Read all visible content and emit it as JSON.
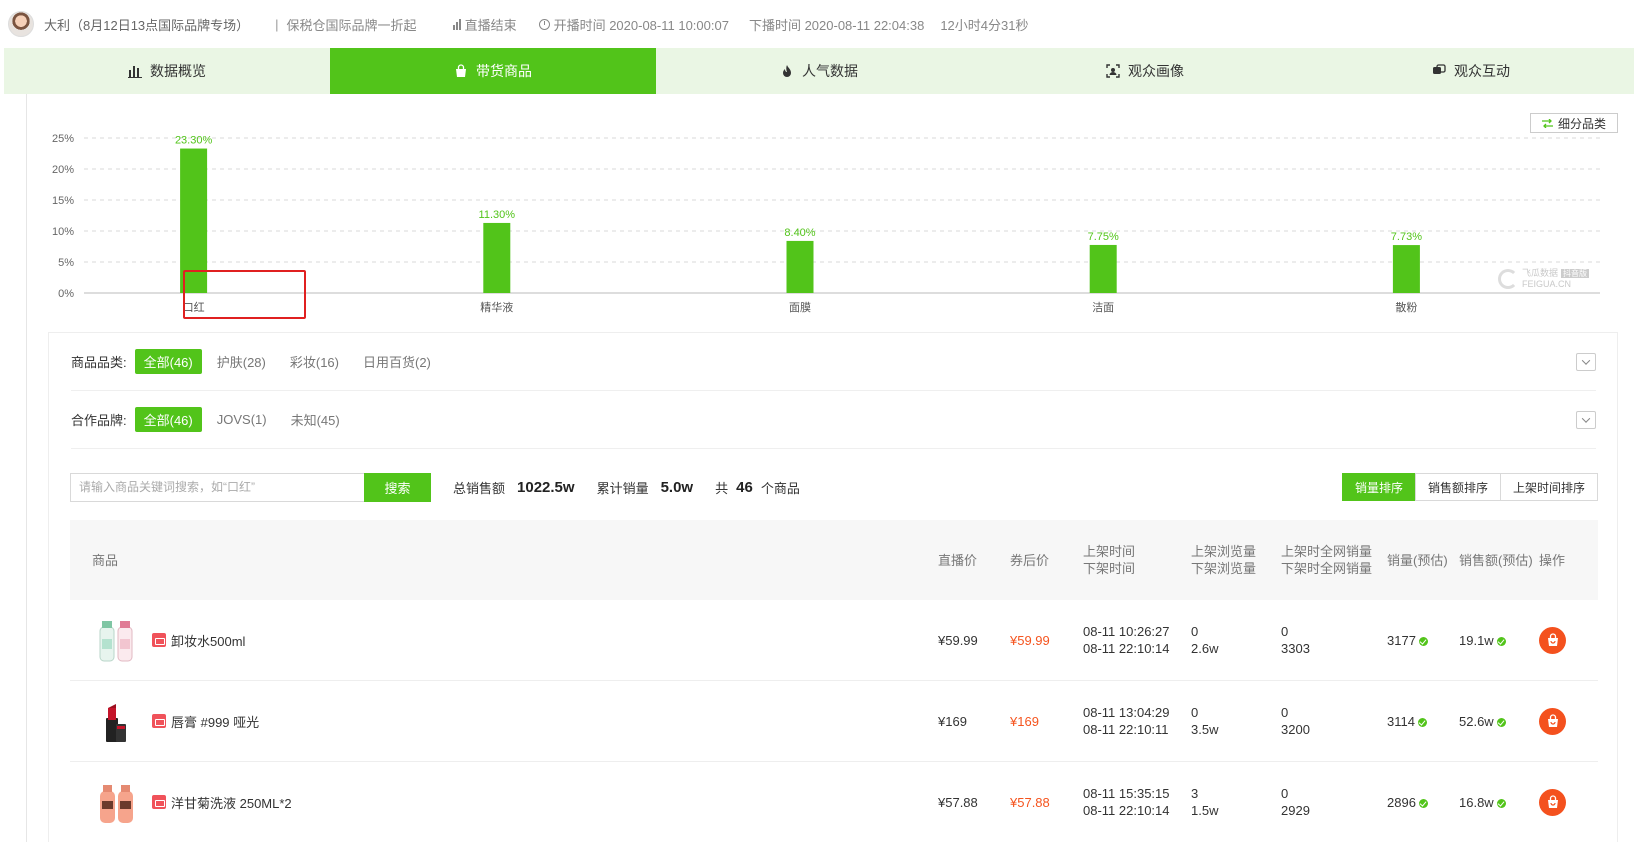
{
  "header": {
    "anchor": "大利（8月12日13点国际品牌专场）",
    "theme": "保税仓国际品牌一折起",
    "status": "直播结束",
    "start": "开播时间 2020-08-11 10:00:07",
    "end": "下播时间 2020-08-11 22:04:38",
    "duration": "12小时4分31秒"
  },
  "tabs": [
    {
      "label": "数据概览",
      "icon": "bar-chart-icon",
      "active": false
    },
    {
      "label": "带货商品",
      "icon": "shopping-bag-icon",
      "active": true
    },
    {
      "label": "人气数据",
      "icon": "fire-icon",
      "active": false
    },
    {
      "label": "观众画像",
      "icon": "user-focus-icon",
      "active": false
    },
    {
      "label": "观众互动",
      "icon": "chat-icon",
      "active": false
    }
  ],
  "subcategory_button": "细分品类",
  "watermark": {
    "brand": "飞瓜数据",
    "tag": "抖音版",
    "domain": "FEIGUA.CN"
  },
  "chart_data": {
    "type": "bar",
    "categories": [
      "口红",
      "精华液",
      "面膜",
      "洁面",
      "散粉"
    ],
    "values": [
      23.3,
      11.3,
      8.4,
      7.75,
      7.73
    ],
    "value_labels": [
      "23.30%",
      "11.30%",
      "8.40%",
      "7.75%",
      "7.73%"
    ],
    "ylim": [
      0,
      25
    ],
    "yticks": [
      "0%",
      "5%",
      "10%",
      "15%",
      "20%",
      "25%"
    ],
    "grid": true,
    "color": "#52c41a"
  },
  "filters": {
    "category": {
      "label": "商品品类:",
      "options": [
        {
          "label": "全部(46)",
          "active": true
        },
        {
          "label": "护肤(28)",
          "active": false
        },
        {
          "label": "彩妆(16)",
          "active": false
        },
        {
          "label": "日用百货(2)",
          "active": false
        }
      ]
    },
    "brand": {
      "label": "合作品牌:",
      "options": [
        {
          "label": "全部(46)",
          "active": true
        },
        {
          "label": "JOVS(1)",
          "active": false
        },
        {
          "label": "未知(45)",
          "active": false
        }
      ]
    }
  },
  "search": {
    "placeholder": "请输入商品关键词搜索，如“口红”",
    "button": "搜索"
  },
  "stats": {
    "total_sales_label": "总销售额",
    "total_sales": "1022.5w",
    "volume_label": "累计销量",
    "volume": "5.0w",
    "count_prefix": "共",
    "count": "46",
    "count_suffix": "个商品"
  },
  "sort": [
    {
      "label": "销量排序",
      "active": true
    },
    {
      "label": "销售额排序",
      "active": false
    },
    {
      "label": "上架时间排序",
      "active": false
    }
  ],
  "table": {
    "headers": {
      "product": "商品",
      "live_price": "直播价",
      "coupon_price": "券后价",
      "time": [
        "上架时间",
        "下架时间"
      ],
      "views": [
        "上架浏览量",
        "下架浏览量"
      ],
      "net_sales": [
        "上架时全网销量",
        "下架时全网销量"
      ],
      "sales": "销量(预估)",
      "amount": "销售额(预估)",
      "op": "操作"
    },
    "rows": [
      {
        "name": "卸妆水500ml",
        "image": "makeup-remover-bottles",
        "live_price": "¥59.99",
        "coupon_price": "¥59.99",
        "on_time": "08-11 10:26:27",
        "off_time": "08-11 22:10:14",
        "on_views": "0",
        "off_views": "2.6w",
        "on_net": "0",
        "off_net": "3303",
        "sales": "3177",
        "amount": "19.1w"
      },
      {
        "name": "唇膏 #999 哑光",
        "image": "lipstick",
        "live_price": "¥169",
        "coupon_price": "¥169",
        "on_time": "08-11 13:04:29",
        "off_time": "08-11 22:10:11",
        "on_views": "0",
        "off_views": "3.5w",
        "on_net": "0",
        "off_net": "3200",
        "sales": "3114",
        "amount": "52.6w"
      },
      {
        "name": "洋甘菊洗液 250ML*2",
        "image": "cleanser-bottles",
        "live_price": "¥57.88",
        "coupon_price": "¥57.88",
        "on_time": "08-11 15:35:15",
        "off_time": "08-11 22:10:14",
        "on_views": "3",
        "off_views": "1.5w",
        "on_net": "0",
        "off_net": "2929",
        "sales": "2896",
        "amount": "16.8w"
      }
    ]
  }
}
